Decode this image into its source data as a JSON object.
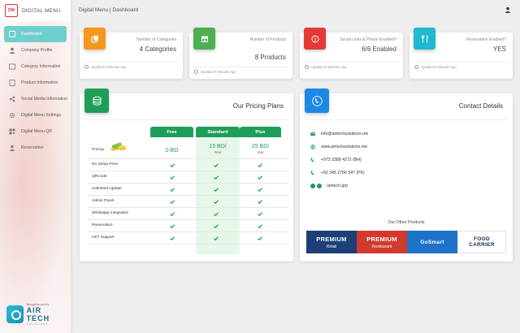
{
  "app": {
    "brand_name": "DIGITAL MENU",
    "breadcrumb": "Digital Menu | Dashboard"
  },
  "sidebar": {
    "items": [
      {
        "label": "Dashboard",
        "icon": "dashboard-icon",
        "active": true
      },
      {
        "label": "Company Profile",
        "icon": "user-icon"
      },
      {
        "label": "Category Information",
        "icon": "folder-icon"
      },
      {
        "label": "Product Information",
        "icon": "product-icon"
      },
      {
        "label": "Social Media Information",
        "icon": "share-icon"
      },
      {
        "label": "Digital Menu Settings",
        "icon": "gear-icon"
      },
      {
        "label": "Digital Menu QR",
        "icon": "qr-icon"
      },
      {
        "label": "Reservation",
        "icon": "reservation-icon"
      }
    ],
    "footer": {
      "small": "Brought to you by",
      "big": "AIR TECH",
      "sub": "SOLUTIONS"
    }
  },
  "stats": [
    {
      "label": "Number of Categories",
      "value": "4 Categories",
      "updated": "Updated 8 Minutes Ago",
      "color": "#f5961e",
      "icon": "copy-icon"
    },
    {
      "label": "Number of Products",
      "value": "8 Products",
      "updated": "Updated 8 Minutes Ago",
      "color": "#4caf50",
      "icon": "store-icon"
    },
    {
      "label": "Social Links & Phone Enabled?",
      "value": "6/6 Enabled",
      "updated": "Updated 8 Minutes Ago",
      "color": "#e53935",
      "icon": "info-icon"
    },
    {
      "label": "Reservation Enabled?",
      "value": "YES",
      "updated": "Updated 8 Minutes Ago",
      "color": "#1eb8d0",
      "icon": "cutlery-icon"
    }
  ],
  "pricing": {
    "title": "Our Pricing Plans",
    "plans": [
      {
        "name": "Free",
        "price": "0 BD",
        "period": ""
      },
      {
        "name": "Standard",
        "price": "15 BD/",
        "period": "Year"
      },
      {
        "name": "Plus",
        "price": "25 BD/",
        "period": "Year"
      }
    ],
    "price_row_label": "Pricing",
    "features": [
      "No Setup Fees",
      "QRCode",
      "Unlimited Update",
      "Admin Panel",
      "Whatsapp Integrated",
      "Reservation",
      "24/7 Support"
    ],
    "accent": "#1f9e57"
  },
  "contact": {
    "title": "Contact Details",
    "rows": [
      {
        "icon": "email-icon",
        "text": "info@airtechsolutions.me"
      },
      {
        "icon": "globe-icon",
        "text": "www.airtechsolutions.me"
      },
      {
        "icon": "phone-icon",
        "text": "+973 3388 4272 (BH)"
      },
      {
        "icon": "phone-icon",
        "text": "+92 345 2766 547 (PK)"
      },
      {
        "icon": "social-icon",
        "text": "/airtech.grp"
      }
    ],
    "other_title": "Our Other Products",
    "products": [
      {
        "name": "PREMIUM",
        "sub": "Retail",
        "color": "#1c3f77"
      },
      {
        "name": "PREMIUM",
        "sub": "Restaurant",
        "color": "#d13a2f"
      },
      {
        "name": "GoSmart",
        "sub": "",
        "color": "#1e73c8"
      },
      {
        "name": "FOOD CARRIER",
        "sub": "",
        "color": "#ffffff"
      }
    ]
  }
}
